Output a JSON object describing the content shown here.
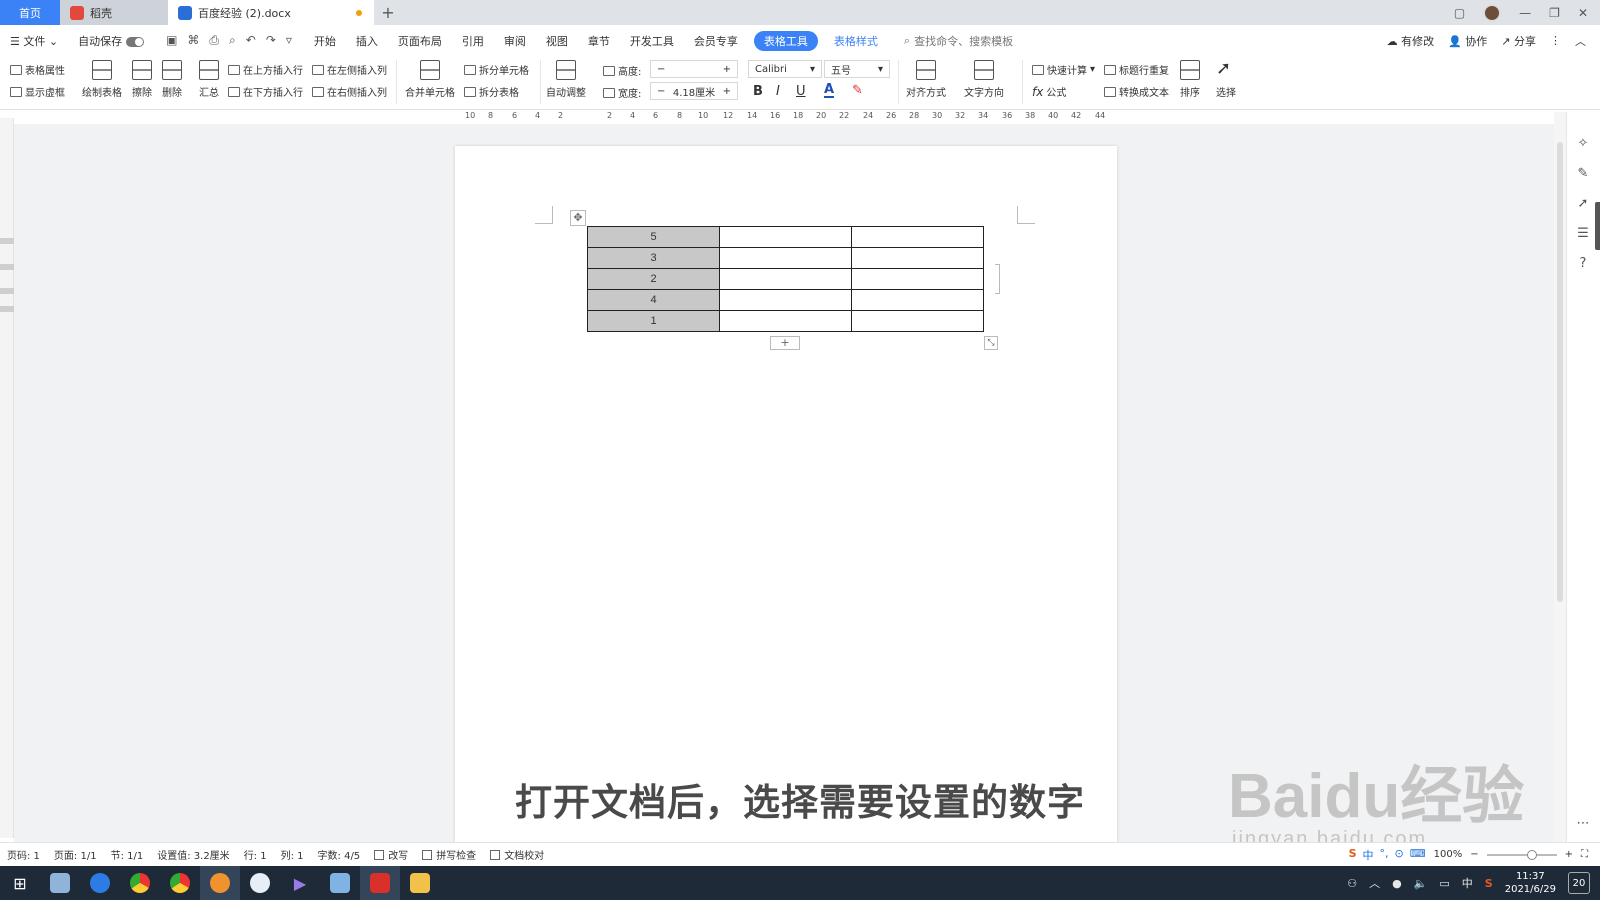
{
  "tabs": {
    "home": "首页",
    "doc1": "稻壳",
    "active_doc": "百度经验 (2).docx",
    "new_tab": "+"
  },
  "menubar": {
    "file": "文件",
    "autosave": "自动保存",
    "items": [
      "开始",
      "插入",
      "页面布局",
      "引用",
      "审阅",
      "视图",
      "章节",
      "开发工具",
      "会员专享"
    ],
    "table_tools": "表格工具",
    "table_style": "表格样式",
    "search_placeholder": "查找命令、搜索模板",
    "modified": "有修改",
    "collab": "协作",
    "share": "分享"
  },
  "ribbon": {
    "table_props": "表格属性",
    "show_grid": "显示虚框",
    "draw_table": "绘制表格",
    "erase": "擦除",
    "delete": "删除",
    "summary": "汇总",
    "insert_above": "在上方插入行",
    "insert_below": "在下方插入行",
    "insert_left": "在左侧插入列",
    "insert_right": "在右侧插入列",
    "merge_cells": "合并单元格",
    "split_cells": "拆分单元格",
    "split_table": "拆分表格",
    "auto_adjust": "自动调整",
    "height_label": "高度:",
    "width_label": "宽度:",
    "height_value": "",
    "width_value": "4.18厘米",
    "font_name": "Calibri",
    "font_size": "五号",
    "bold": "B",
    "italic": "I",
    "underline": "U",
    "font_color": "A",
    "align": "对齐方式",
    "text_dir": "文字方向",
    "quick_calc": "快速计算",
    "formula": "公式",
    "repeat_header": "标题行重复",
    "to_text": "转换成文本",
    "sort": "排序",
    "select": "选择"
  },
  "ruler_ticks": [
    "10",
    "8",
    "6",
    "4",
    "2",
    "2",
    "4",
    "6",
    "8",
    "10",
    "12",
    "14",
    "16",
    "18",
    "20",
    "22",
    "24",
    "26",
    "28",
    "30",
    "32",
    "34",
    "36",
    "38",
    "40",
    "42",
    "44"
  ],
  "table": {
    "rows": [
      [
        "5",
        "",
        ""
      ],
      [
        "3",
        "",
        ""
      ],
      [
        "2",
        "",
        ""
      ],
      [
        "4",
        "",
        ""
      ],
      [
        "1",
        "",
        ""
      ]
    ]
  },
  "subtitle": "打开文档后，选择需要设置的数字",
  "watermark": {
    "main": "Baidu经验",
    "sub": "jingyan.baidu.com"
  },
  "status": {
    "page_num": "页码: 1",
    "pages": "页面: 1/1",
    "section": "节: 1/1",
    "setting": "设置值: 3.2厘米",
    "row": "行: 1",
    "col": "列: 1",
    "words": "字数: 4/5",
    "revise": "改写",
    "spell": "拼写检查",
    "proof": "文档校对",
    "zoom": "100%"
  },
  "taskbar": {
    "time": "11:37",
    "date": "2021/6/29",
    "lang": "中",
    "notif": "20"
  },
  "colors": {
    "accent": "#3b82f6",
    "taskbar": "#1f2a38",
    "selected_cell": "#c8c8c8"
  }
}
